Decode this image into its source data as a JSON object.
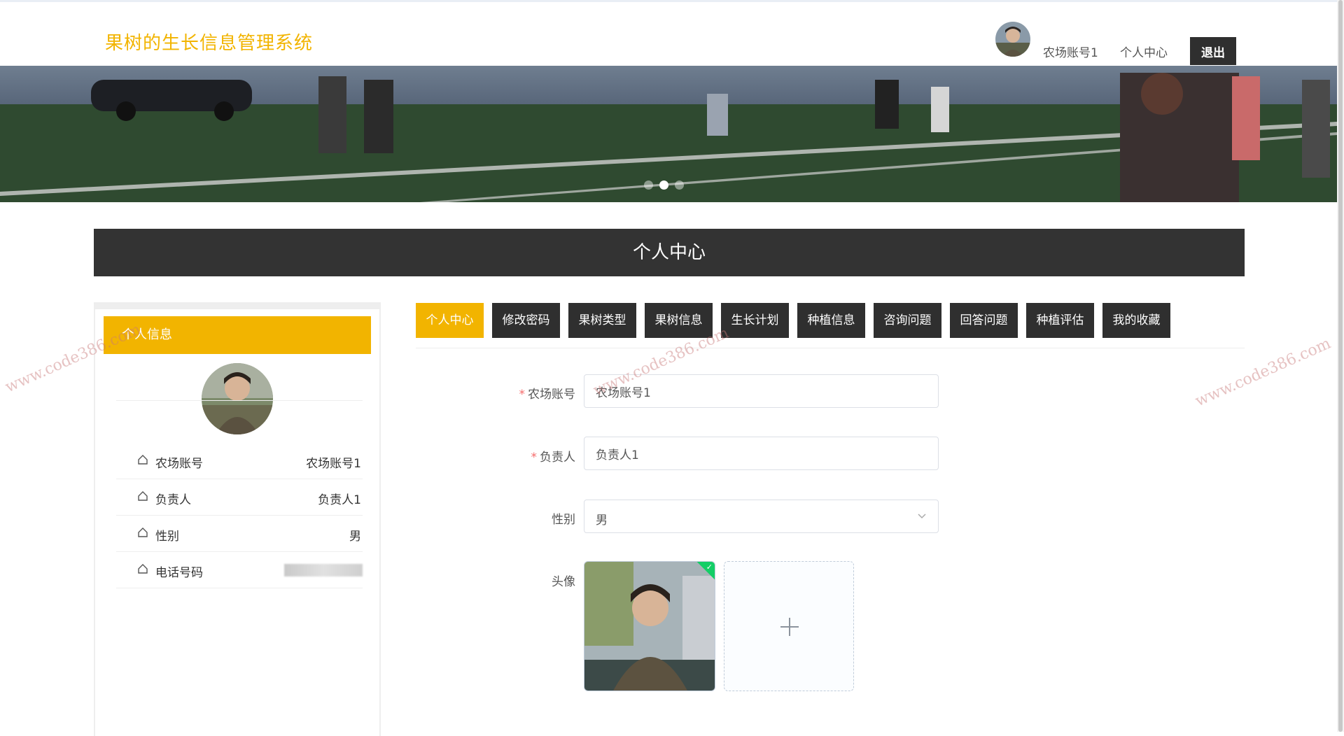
{
  "header": {
    "title": "果树的生长信息管理系统",
    "username": "农场账号1",
    "personal_center": "个人中心",
    "logout": "退出"
  },
  "banner": {
    "slides_total": 3,
    "active_slide": 2
  },
  "section": {
    "title": "个人中心"
  },
  "sidebar": {
    "info_title": "个人信息",
    "rows": [
      {
        "label": "农场账号",
        "value": "农场账号1"
      },
      {
        "label": "负责人",
        "value": "负责人1"
      },
      {
        "label": "性别",
        "value": "男"
      },
      {
        "label": "电话号码",
        "value": ""
      }
    ]
  },
  "tabs": [
    {
      "label": "个人中心",
      "active": true
    },
    {
      "label": "修改密码",
      "active": false
    },
    {
      "label": "果树类型",
      "active": false
    },
    {
      "label": "果树信息",
      "active": false
    },
    {
      "label": "生长计划",
      "active": false
    },
    {
      "label": "种植信息",
      "active": false
    },
    {
      "label": "咨询问题",
      "active": false
    },
    {
      "label": "回答问题",
      "active": false
    },
    {
      "label": "种植评估",
      "active": false
    },
    {
      "label": "我的收藏",
      "active": false
    }
  ],
  "form": {
    "account_label": "农场账号",
    "account_value": "农场账号1",
    "manager_label": "负责人",
    "manager_value": "负责人1",
    "gender_label": "性别",
    "gender_value": "男",
    "avatar_label": "头像",
    "required_mark": "*",
    "add_icon": "plus-icon"
  },
  "watermarks": [
    "www.code386.com",
    "www.code386.com",
    "www.code386.com"
  ],
  "colors": {
    "accent": "#f2b400",
    "dark": "#2f2f2f",
    "success": "#13ce66"
  }
}
